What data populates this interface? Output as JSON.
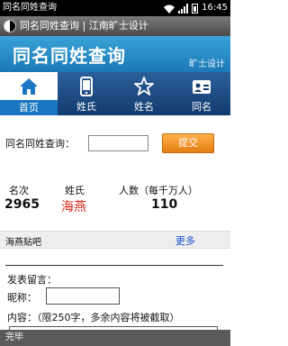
{
  "statusbar": {
    "app_name": "同名同姓查询",
    "time": "16:45"
  },
  "titlebar": {
    "title": "同名同姓查询 | 江南旷士设计"
  },
  "banner": {
    "title": "同名同姓查询",
    "brand": "旷士设计"
  },
  "tabs": [
    {
      "label": "首页",
      "icon": "home-icon",
      "active": true
    },
    {
      "label": "姓氏",
      "icon": "phone-icon",
      "active": false
    },
    {
      "label": "姓名",
      "icon": "star-icon",
      "active": false
    },
    {
      "label": "同名",
      "icon": "id-card-icon",
      "active": false
    }
  ],
  "search": {
    "label": "同名同姓查询：",
    "value": "",
    "placeholder": "",
    "button": "提交"
  },
  "stats": {
    "rank_header": "名次",
    "surname_header": "姓氏",
    "count_header": "人数（每千万人）",
    "rank": "2965",
    "surname": "海燕",
    "count": "110"
  },
  "section": {
    "title": "海燕贴吧",
    "more": "更多"
  },
  "form": {
    "heading": "发表留言：",
    "nickname_label": "昵称：",
    "nickname_value": "",
    "content_label": "内容：（限250字，多余内容将被截取）"
  },
  "bottombar": {
    "status": "完毕"
  },
  "colors": {
    "accent_blue": "#1b76c2",
    "banner_blue": "#2a90cc",
    "button_orange": "#f0901e",
    "highlight_red": "#d8261c",
    "link_blue": "#1a4fd0"
  }
}
